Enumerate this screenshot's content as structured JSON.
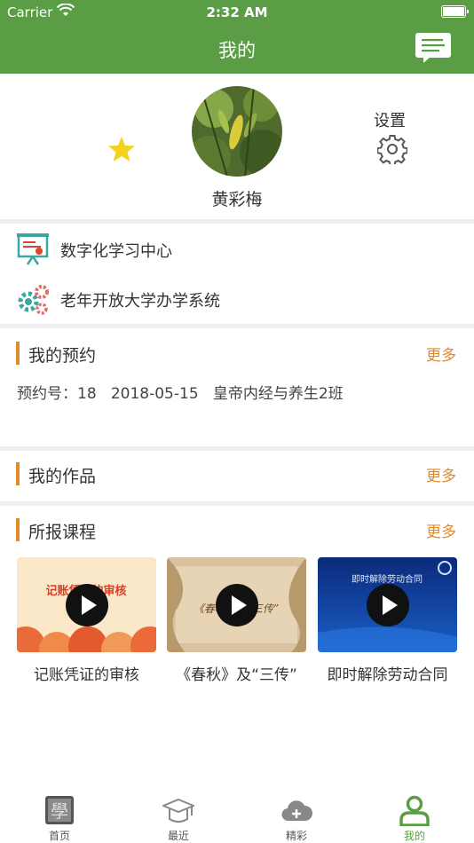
{
  "status_bar": {
    "carrier": "Carrier",
    "time": "2:32 AM"
  },
  "nav": {
    "title": "我的",
    "message_icon": "message-icon"
  },
  "profile": {
    "name": "黄彩梅",
    "settings_label": "设置",
    "star_icon": "star-icon",
    "gear_icon": "gear-icon"
  },
  "links": [
    {
      "label": "数字化学习中心",
      "icon": "presentation-board-icon"
    },
    {
      "label": "老年开放大学办学系统",
      "icon": "gears-icon"
    }
  ],
  "reservations": {
    "title": "我的预约",
    "more": "更多",
    "item": "预约号：18   2018-05-15   皇帝内经与养生2班"
  },
  "works": {
    "title": "我的作品",
    "more": "更多"
  },
  "courses": {
    "title": "所报课程",
    "more": "更多",
    "items": [
      {
        "title": "记账凭证的审核",
        "thumb_text": "记账凭证的审核"
      },
      {
        "title": "《春秋》及“三传”",
        "thumb_text": "《春秋》及“三传”"
      },
      {
        "title": "即时解除劳动合同",
        "thumb_text": "即时解除劳动合同"
      }
    ]
  },
  "tabs": [
    {
      "label": "首页",
      "icon": "study-icon"
    },
    {
      "label": "最近",
      "icon": "graduation-cap-icon"
    },
    {
      "label": "精彩",
      "icon": "cloud-plus-icon"
    },
    {
      "label": "我的",
      "icon": "user-icon",
      "active": true
    }
  ],
  "colors": {
    "brand_green": "#5a9d45",
    "accent_orange": "#e08a2a"
  }
}
